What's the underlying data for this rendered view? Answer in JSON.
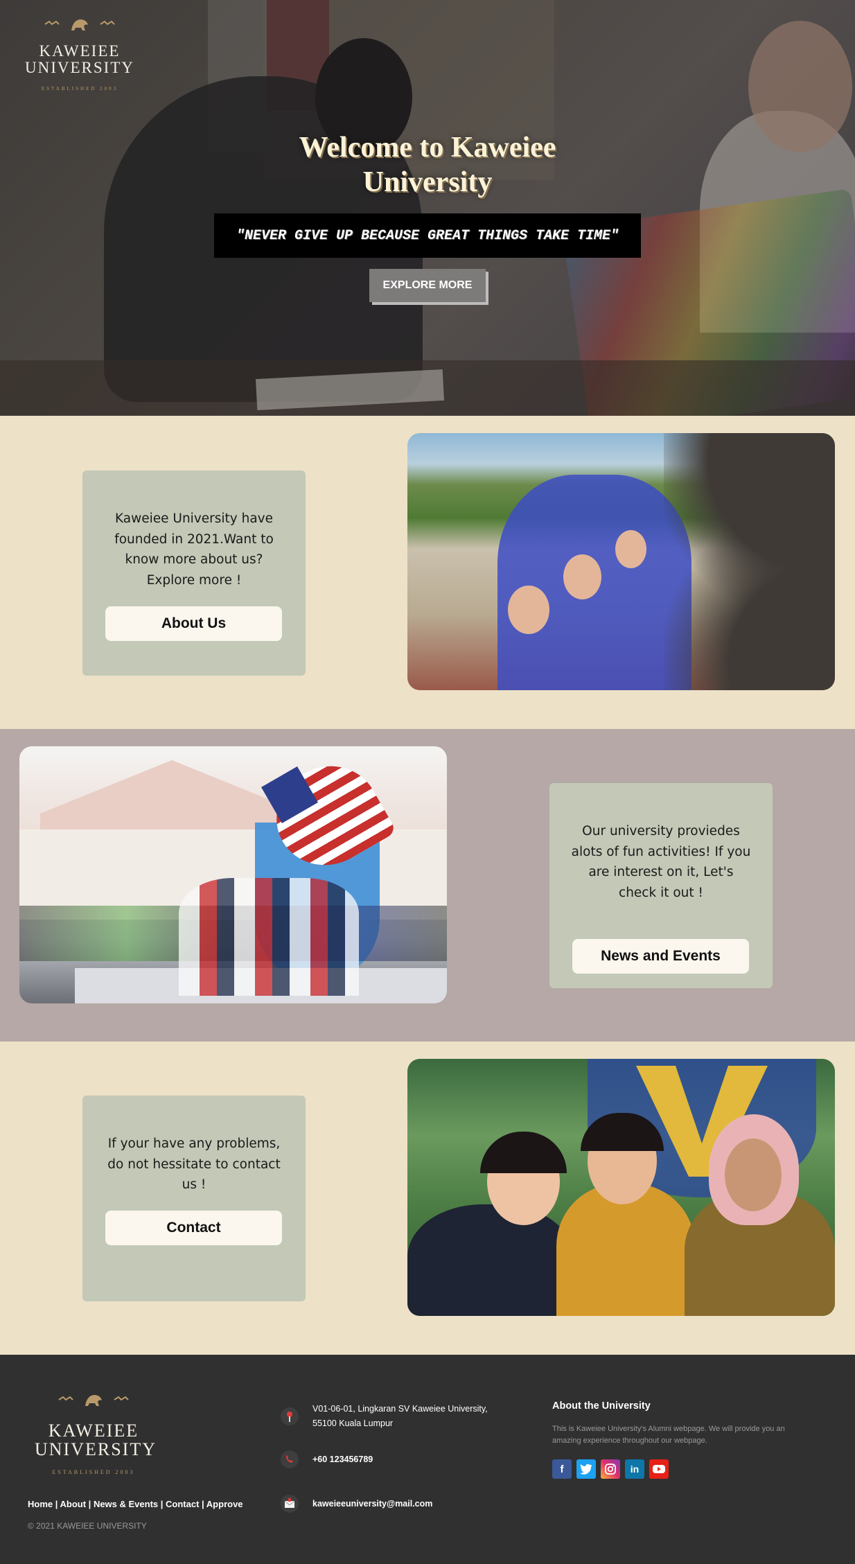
{
  "brand": {
    "name_line1": "KAWEIEE",
    "name_line2": "UNIVERSITY",
    "established": "ESTABLISHED 2003"
  },
  "hero": {
    "title": "Welcome to Kaweiee University",
    "quote": "\"NEVER GIVE UP BECAUSE GREAT THINGS TAKE TIME\"",
    "button": "EXPLORE MORE"
  },
  "sections": [
    {
      "text": "Kaweiee University have founded in 2021.Want to know more about us? Explore more !",
      "button": "About Us"
    },
    {
      "text": "Our university proviedes alots of fun activities! If you are interest on it, Let's check it out !",
      "button": "News and Events"
    },
    {
      "text": "If your have any problems, do not hessitate to contact us !",
      "button": "Contact"
    }
  ],
  "footer": {
    "nav": [
      "Home",
      "About",
      "News & Events",
      "Contact",
      "Approve"
    ],
    "nav_separator": " | ",
    "copyright": "© 2021 KAWEIEE UNIVERSITY",
    "address_line1": "V01-06-01, Lingkaran SV Kaweiee University,",
    "address_line2": "55100 Kuala Lumpur",
    "phone": "+60 123456789",
    "email": "kaweieeuniversity@mail.com",
    "about_title": "About the University",
    "about_text": "This is Kaweiee University's Alumni webpage. We will provide you an amazing experience throughout our webpage.",
    "socials": [
      {
        "icon": "facebook-icon",
        "glyph": "f",
        "color": "#3b5998"
      },
      {
        "icon": "twitter-icon",
        "glyph": "t",
        "color": "#1da1f2"
      },
      {
        "icon": "instagram-icon",
        "glyph": "◎",
        "color": "#c13584"
      },
      {
        "icon": "linkedin-icon",
        "glyph": "in",
        "color": "#0e76a8"
      },
      {
        "icon": "youtube-icon",
        "glyph": "▶",
        "color": "#e62117"
      }
    ]
  },
  "colors": {
    "cream": "#ede1c7",
    "mauve": "#b5a8a6",
    "sage": "#c3c8b7",
    "footer": "#303030",
    "gold": "#b89a6a"
  }
}
